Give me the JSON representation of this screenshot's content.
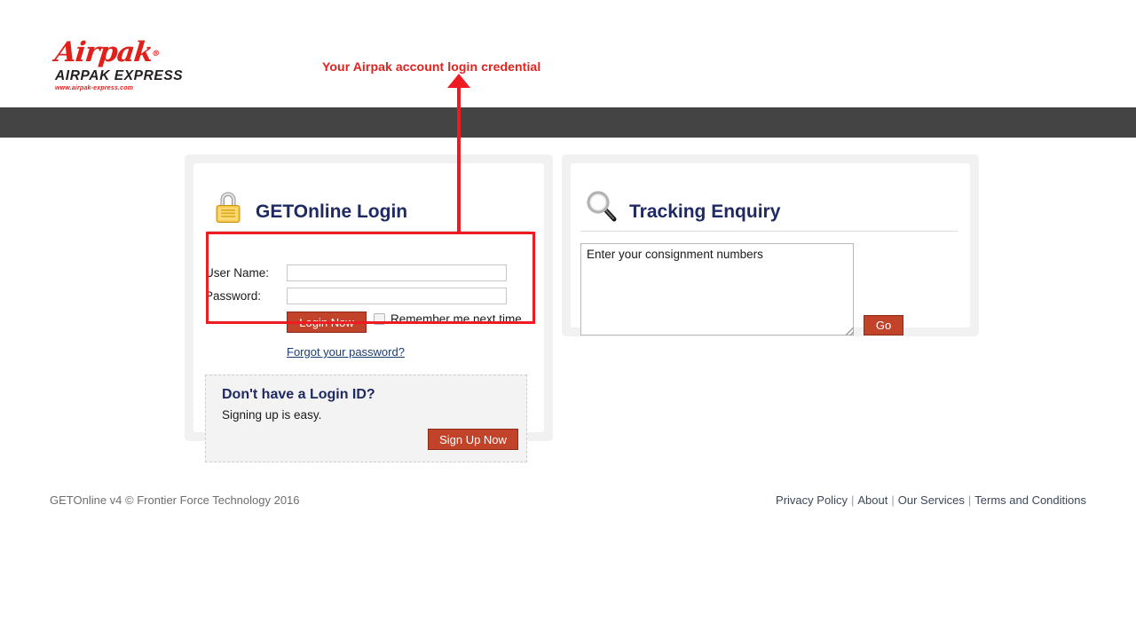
{
  "brand": {
    "script_name": "Airpak",
    "registered_mark": "®",
    "company_name": "AIRPAK EXPRESS",
    "website": "www.airpak-express.com",
    "red": "#e0201b"
  },
  "annotation": {
    "text": "Your Airpak account login credential",
    "color": "#ee1c22",
    "arrow": "up-arrow-icon",
    "highlight_box": "login-credentials-region"
  },
  "navbar": {
    "background": "#444444",
    "items": []
  },
  "login_panel": {
    "icon": "padlock-icon",
    "title": "GETOnline Login",
    "username": {
      "label": "User Name:",
      "value": "",
      "placeholder": ""
    },
    "password": {
      "label": "Password:",
      "value": "",
      "placeholder": ""
    },
    "login_button": "Login Now",
    "remember_label": "Remember me next time.",
    "remember_checked": false,
    "forgot_link": "Forgot your password?",
    "signup": {
      "heading": "Don't have a Login ID?",
      "subtext": "Signing up is easy.",
      "button": "Sign Up Now"
    },
    "button_color": "#c0432a",
    "title_color": "#1f2a63"
  },
  "tracking_panel": {
    "icon": "magnifying-glass-icon",
    "title": "Tracking Enquiry",
    "textarea": {
      "value": "Enter your consignment numbers",
      "placeholder": "Enter your consignment numbers"
    },
    "go_button": "Go"
  },
  "footer": {
    "copyright": "GETOnline v4 © Frontier Force Technology 2016",
    "links": [
      "Privacy Policy",
      "About",
      "Our Services",
      "Terms and Conditions"
    ],
    "separator": "|"
  }
}
